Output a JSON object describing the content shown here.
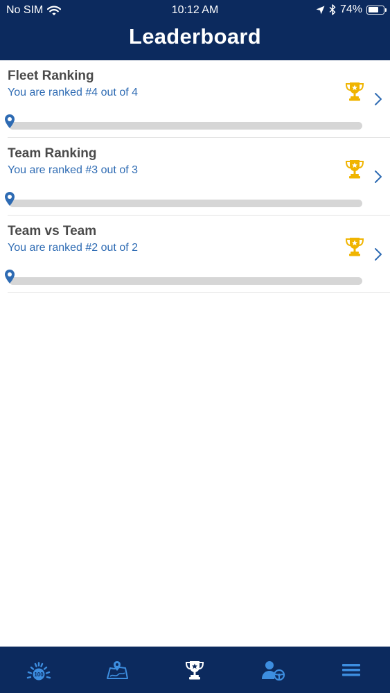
{
  "status_bar": {
    "carrier": "No SIM",
    "time": "10:12 AM",
    "battery": "74%",
    "battery_level": 0.74
  },
  "header": {
    "title": "Leaderboard"
  },
  "leaderboards": [
    {
      "title": "Fleet Ranking",
      "subtitle": "You are ranked #4 out of 4",
      "progress": 0
    },
    {
      "title": "Team Ranking",
      "subtitle": "You are ranked #3 out of 3",
      "progress": 0
    },
    {
      "title": "Team vs Team",
      "subtitle": "You are ranked #2 out of 2",
      "progress": 0
    }
  ],
  "tab_bar": {
    "tabs": [
      {
        "icon": "speedometer-100-icon",
        "active": false
      },
      {
        "icon": "map-pin-icon",
        "active": false
      },
      {
        "icon": "trophy-icon",
        "active": true
      },
      {
        "icon": "driver-icon",
        "active": false
      },
      {
        "icon": "menu-icon",
        "active": false
      }
    ]
  },
  "colors": {
    "header_bg": "#0c2a5e",
    "accent_blue": "#2e6bb3",
    "trophy_gold": "#f0b400",
    "title_text": "#4a4a4a",
    "track_gray": "#d6d6d6"
  }
}
